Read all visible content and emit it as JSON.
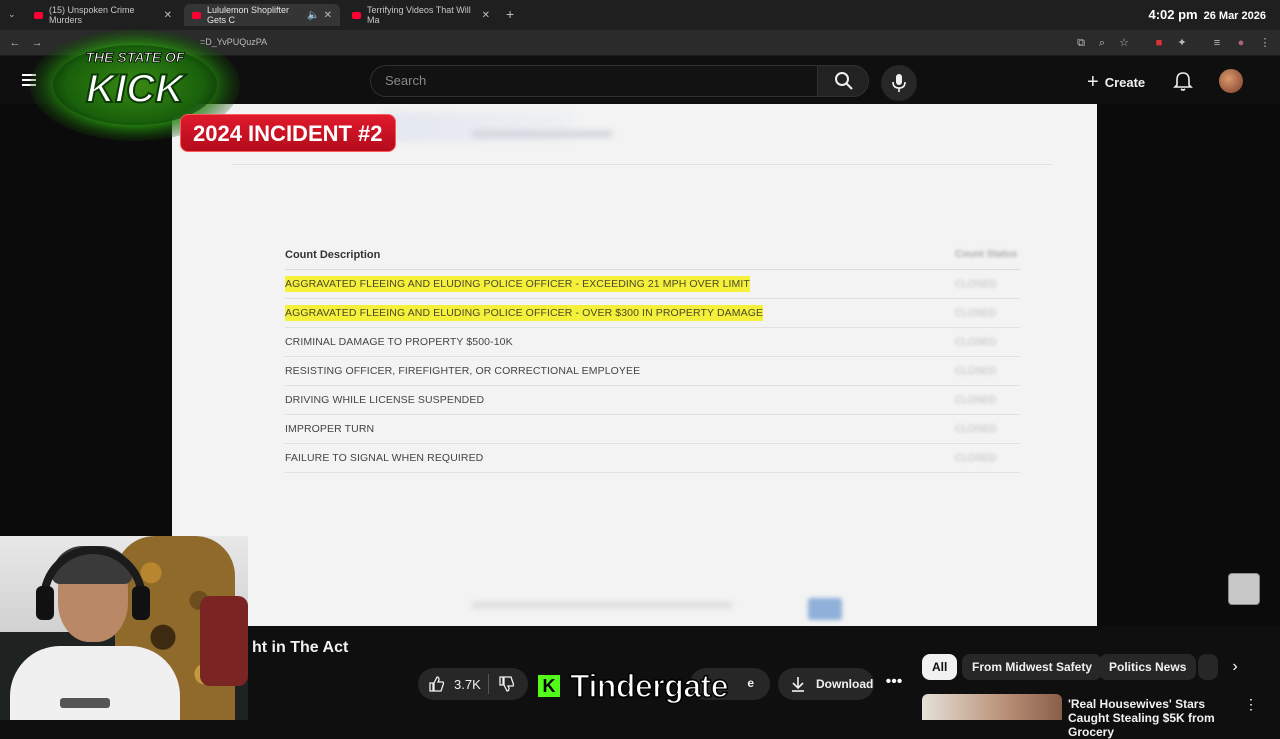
{
  "browser": {
    "tabs": [
      {
        "title": "(15) Unspoken Crime Murders"
      },
      {
        "title": "Lululemon Shoplifter Gets C"
      },
      {
        "title": "Terrifying Videos That Will Ma"
      }
    ],
    "clock": {
      "time": "4:02 pm",
      "date": "26 Mar 2026"
    },
    "url": "=D_YvPUQuzPA"
  },
  "masthead": {
    "search_placeholder": "Search",
    "create_label": "Create"
  },
  "overlay": {
    "logo_line1": "THE STATE OF",
    "logo_line2": "KICK",
    "incident_label": "2024 INCIDENT #2"
  },
  "document": {
    "table_header": "Count Description",
    "status_header": "Count Status",
    "rows": [
      {
        "text": "AGGRAVATED FLEEING AND ELUDING POLICE OFFICER - EXCEEDING 21 MPH OVER LIMIT",
        "highlighted": true,
        "status": "CLOSED"
      },
      {
        "text": "AGGRAVATED FLEEING AND ELUDING POLICE OFFICER - OVER $300 IN PROPERTY DAMAGE",
        "highlighted": true,
        "status": "CLOSED"
      },
      {
        "text": "CRIMINAL DAMAGE TO PROPERTY $500-10K",
        "highlighted": false,
        "status": "CLOSED"
      },
      {
        "text": "RESISTING OFFICER, FIREFIGHTER, OR CORRECTIONAL EMPLOYEE",
        "highlighted": false,
        "status": "CLOSED"
      },
      {
        "text": "DRIVING WHILE LICENSE SUSPENDED",
        "highlighted": false,
        "status": "CLOSED"
      },
      {
        "text": "IMPROPER TURN",
        "highlighted": false,
        "status": "CLOSED"
      },
      {
        "text": "FAILURE TO SIGNAL WHEN REQUIRED",
        "highlighted": false,
        "status": "CLOSED"
      }
    ]
  },
  "below_video": {
    "title_fragment": "ht in The Act",
    "like_count": "3.7K",
    "streamer_name": "Tindergate",
    "share_fragment": "e",
    "download_label": "Download",
    "more_label": "•••"
  },
  "chips": [
    "All",
    "From Midwest Safety",
    "Politics News"
  ],
  "recommendation": {
    "title": "'Real Housewives' Stars Caught Stealing $5K from Grocery"
  },
  "colors": {
    "highlight": "#f5f03a",
    "incident_red": "#d4152a",
    "kick_green": "#53fc18"
  }
}
